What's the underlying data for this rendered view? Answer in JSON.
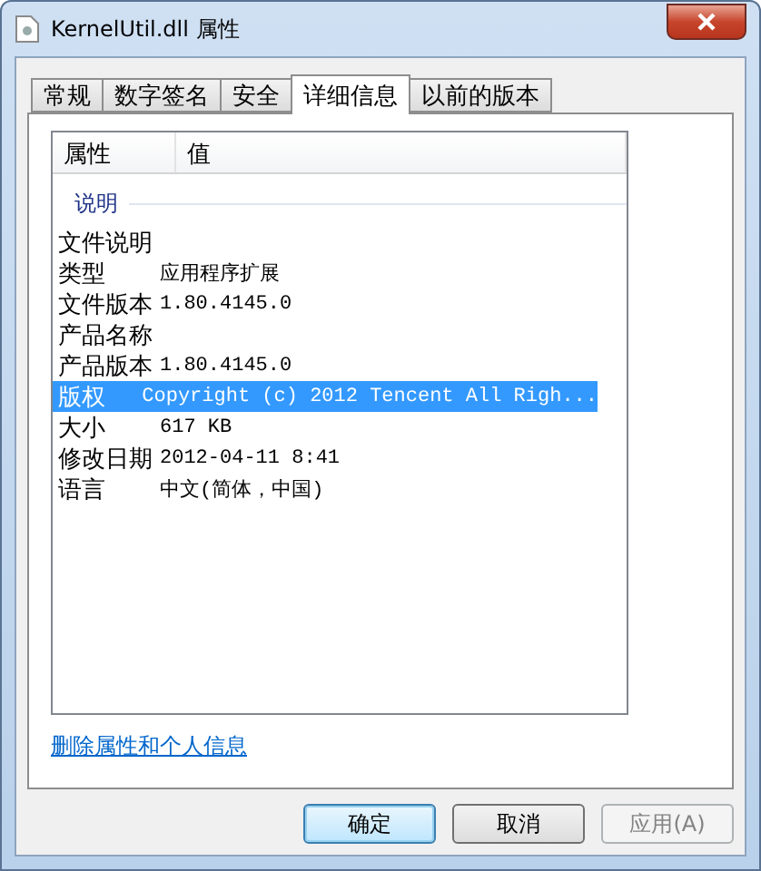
{
  "window": {
    "title": "KernelUtil.dll 属性"
  },
  "tabs": [
    {
      "label": "常规",
      "selected": false
    },
    {
      "label": "数字签名",
      "selected": false
    },
    {
      "label": "安全",
      "selected": false
    },
    {
      "label": "详细信息",
      "selected": true
    },
    {
      "label": "以前的版本",
      "selected": false
    }
  ],
  "table": {
    "columns": [
      "属性",
      "值"
    ],
    "group": "说明",
    "rows": [
      {
        "property": "文件说明",
        "value": "",
        "selected": false
      },
      {
        "property": "类型",
        "value": "应用程序扩展",
        "selected": false
      },
      {
        "property": "文件版本",
        "value": "1.80.4145.0",
        "selected": false
      },
      {
        "property": "产品名称",
        "value": "",
        "selected": false
      },
      {
        "property": "产品版本",
        "value": "1.80.4145.0",
        "selected": false
      },
      {
        "property": "版权",
        "value": "Copyright (c) 2012 Tencent All Righ...",
        "selected": true
      },
      {
        "property": "大小",
        "value": "617 KB",
        "selected": false
      },
      {
        "property": "修改日期",
        "value": "2012-04-11 8:41",
        "selected": false
      },
      {
        "property": "语言",
        "value": "中文(简体，中国)",
        "selected": false
      }
    ]
  },
  "link": "删除属性和个人信息",
  "buttons": [
    {
      "label": "确定",
      "default": true,
      "disabled": false
    },
    {
      "label": "取消",
      "default": false,
      "disabled": false
    },
    {
      "label": "应用(A)",
      "default": false,
      "disabled": true
    }
  ]
}
